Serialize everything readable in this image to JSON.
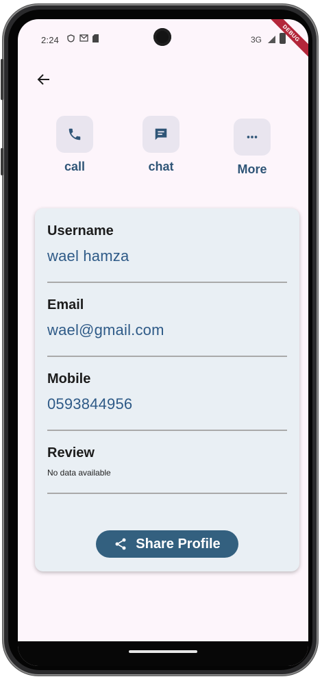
{
  "status_bar": {
    "time": "2:24",
    "icons": [
      "shield-icon",
      "gmail-icon",
      "sim-icon"
    ],
    "network": "3G",
    "debug_banner": "DEBUG"
  },
  "header": {
    "back_icon": "arrow-back-icon"
  },
  "actions": [
    {
      "label": "call",
      "icon": "phone-icon"
    },
    {
      "label": "chat",
      "icon": "chat-bubble-icon"
    },
    {
      "label": "More",
      "icon": "more-horiz-icon"
    }
  ],
  "profile": {
    "fields": [
      {
        "label": "Username",
        "value": "wael hamza"
      },
      {
        "label": "Email",
        "value": "wael@gmail.com"
      },
      {
        "label": "Mobile",
        "value": "0593844956"
      },
      {
        "label": "Review",
        "value": "No data available"
      }
    ],
    "share_label": "Share Profile",
    "share_icon": "share-icon"
  },
  "colors": {
    "accent": "#33607f",
    "value_text": "#2e5a87",
    "card_bg": "#e9eff4",
    "screen_bg": "#fdf5fb"
  }
}
